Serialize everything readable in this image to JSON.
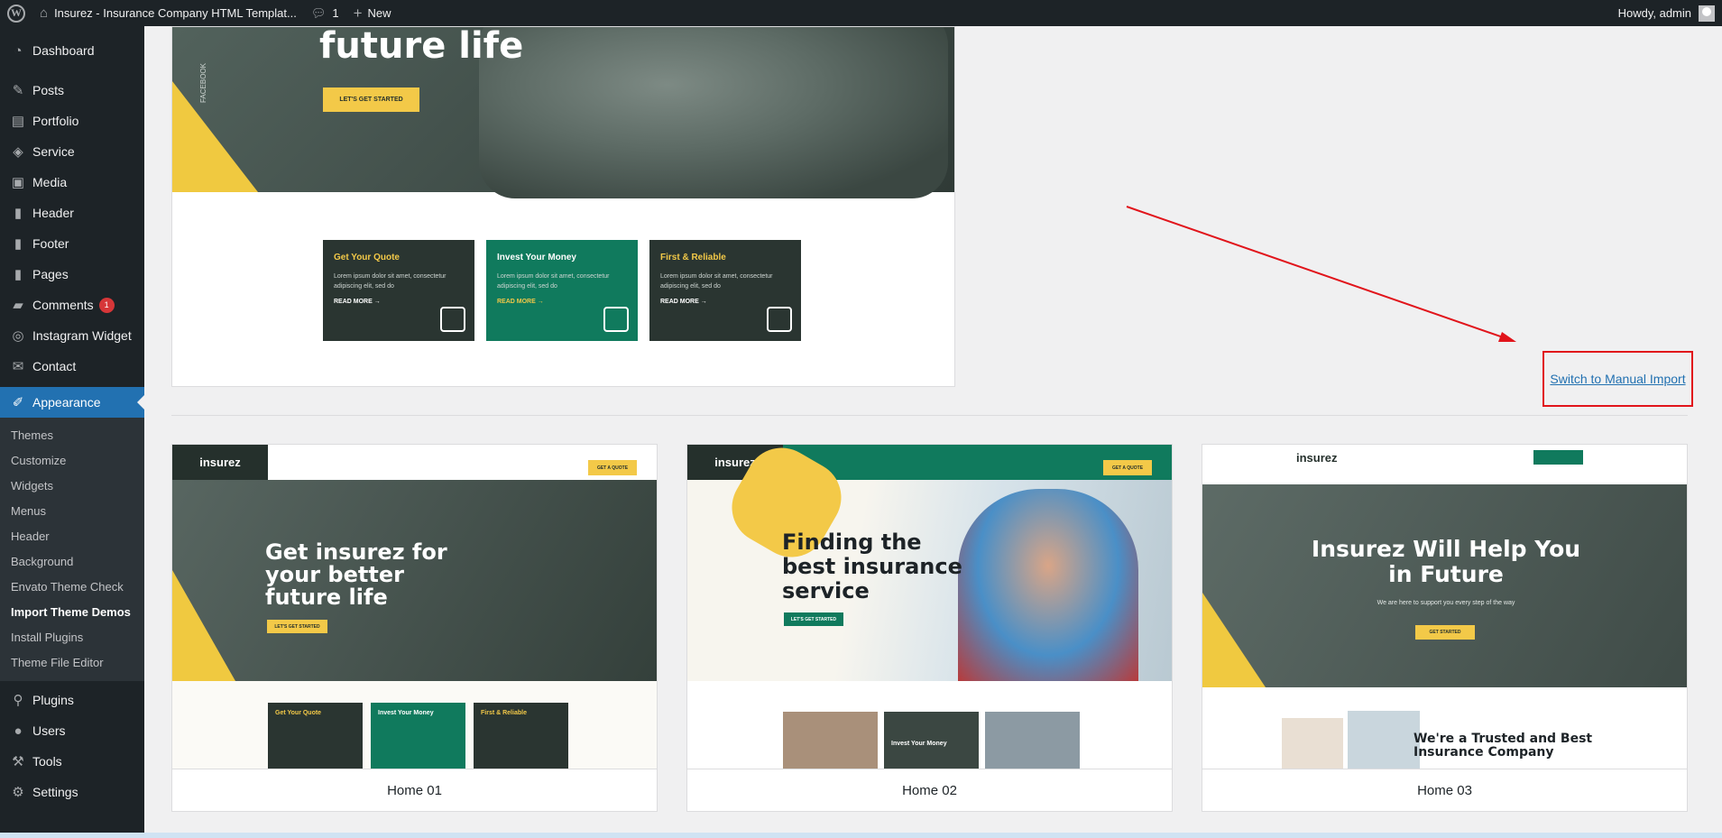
{
  "adminbar": {
    "site_title": "Insurez - Insurance Company HTML Templat...",
    "comments_count": "1",
    "new_label": "New",
    "howdy": "Howdy, admin"
  },
  "sidebar": {
    "items": [
      {
        "label": "Dashboard",
        "icon": "dashboard-icon"
      },
      {
        "label": "Posts",
        "icon": "pin-icon"
      },
      {
        "label": "Portfolio",
        "icon": "portfolio-icon"
      },
      {
        "label": "Service",
        "icon": "shield-icon"
      },
      {
        "label": "Media",
        "icon": "media-icon"
      },
      {
        "label": "Header",
        "icon": "page-icon"
      },
      {
        "label": "Footer",
        "icon": "page-icon"
      },
      {
        "label": "Pages",
        "icon": "pages-icon"
      },
      {
        "label": "Comments",
        "icon": "comment-icon",
        "badge": "1"
      },
      {
        "label": "Instagram Widget",
        "icon": "instagram-icon"
      },
      {
        "label": "Contact",
        "icon": "mail-icon"
      },
      {
        "label": "Appearance",
        "icon": "brush-icon"
      },
      {
        "label": "Plugins",
        "icon": "plugin-icon"
      },
      {
        "label": "Users",
        "icon": "users-icon"
      },
      {
        "label": "Tools",
        "icon": "wrench-icon"
      },
      {
        "label": "Settings",
        "icon": "settings-icon"
      }
    ],
    "appearance_submenu": [
      "Themes",
      "Customize",
      "Widgets",
      "Menus",
      "Header",
      "Background",
      "Envato Theme Check",
      "Import Theme Demos",
      "Install Plugins",
      "Theme File Editor"
    ]
  },
  "top_preview": {
    "hero_title": "future life",
    "hero_button": "LET'S GET STARTED",
    "social_label": "FACEBOOK",
    "cards": [
      {
        "title": "Get Your Quote",
        "text": "Lorem ipsum dolor sit amet, consectetur adipiscing elit, sed do",
        "more": "READ MORE →",
        "style": "dark",
        "title_color": "#f3c948"
      },
      {
        "title": "Invest Your Money",
        "text": "Lorem ipsum dolor sit amet, consectetur adipiscing elit, sed do",
        "more": "READ MORE →",
        "style": "green",
        "title_color": "#ffffff"
      },
      {
        "title": "First & Reliable",
        "text": "Lorem ipsum dolor sit amet, consectetur adipiscing elit, sed do",
        "more": "READ MORE →",
        "style": "dark",
        "title_color": "#f3c948"
      }
    ]
  },
  "manual_import_link": "Switch to Manual Import",
  "themes": [
    {
      "name": "Home 01",
      "logo": "insurez",
      "hero_heading": "Get insurez for your better future life",
      "button": "LET'S GET STARTED"
    },
    {
      "name": "Home 02",
      "logo": "insurez",
      "hero_heading": "Finding the best insurance service",
      "button": "LET'S GET STARTED"
    },
    {
      "name": "Home 03",
      "logo": "insurez",
      "hero_heading": "Insurez Will Help You in Future",
      "sub": "We are here to support you every step of the way",
      "lower_heading": "We're a Trusted and Best Insurance Company",
      "button": "GET STARTED"
    }
  ],
  "colors": {
    "admin_dark": "#1d2327",
    "accent_blue": "#2271b1",
    "brand_yellow": "#f3c948",
    "brand_green": "#107a5d",
    "highlight_red": "#e1141b"
  }
}
